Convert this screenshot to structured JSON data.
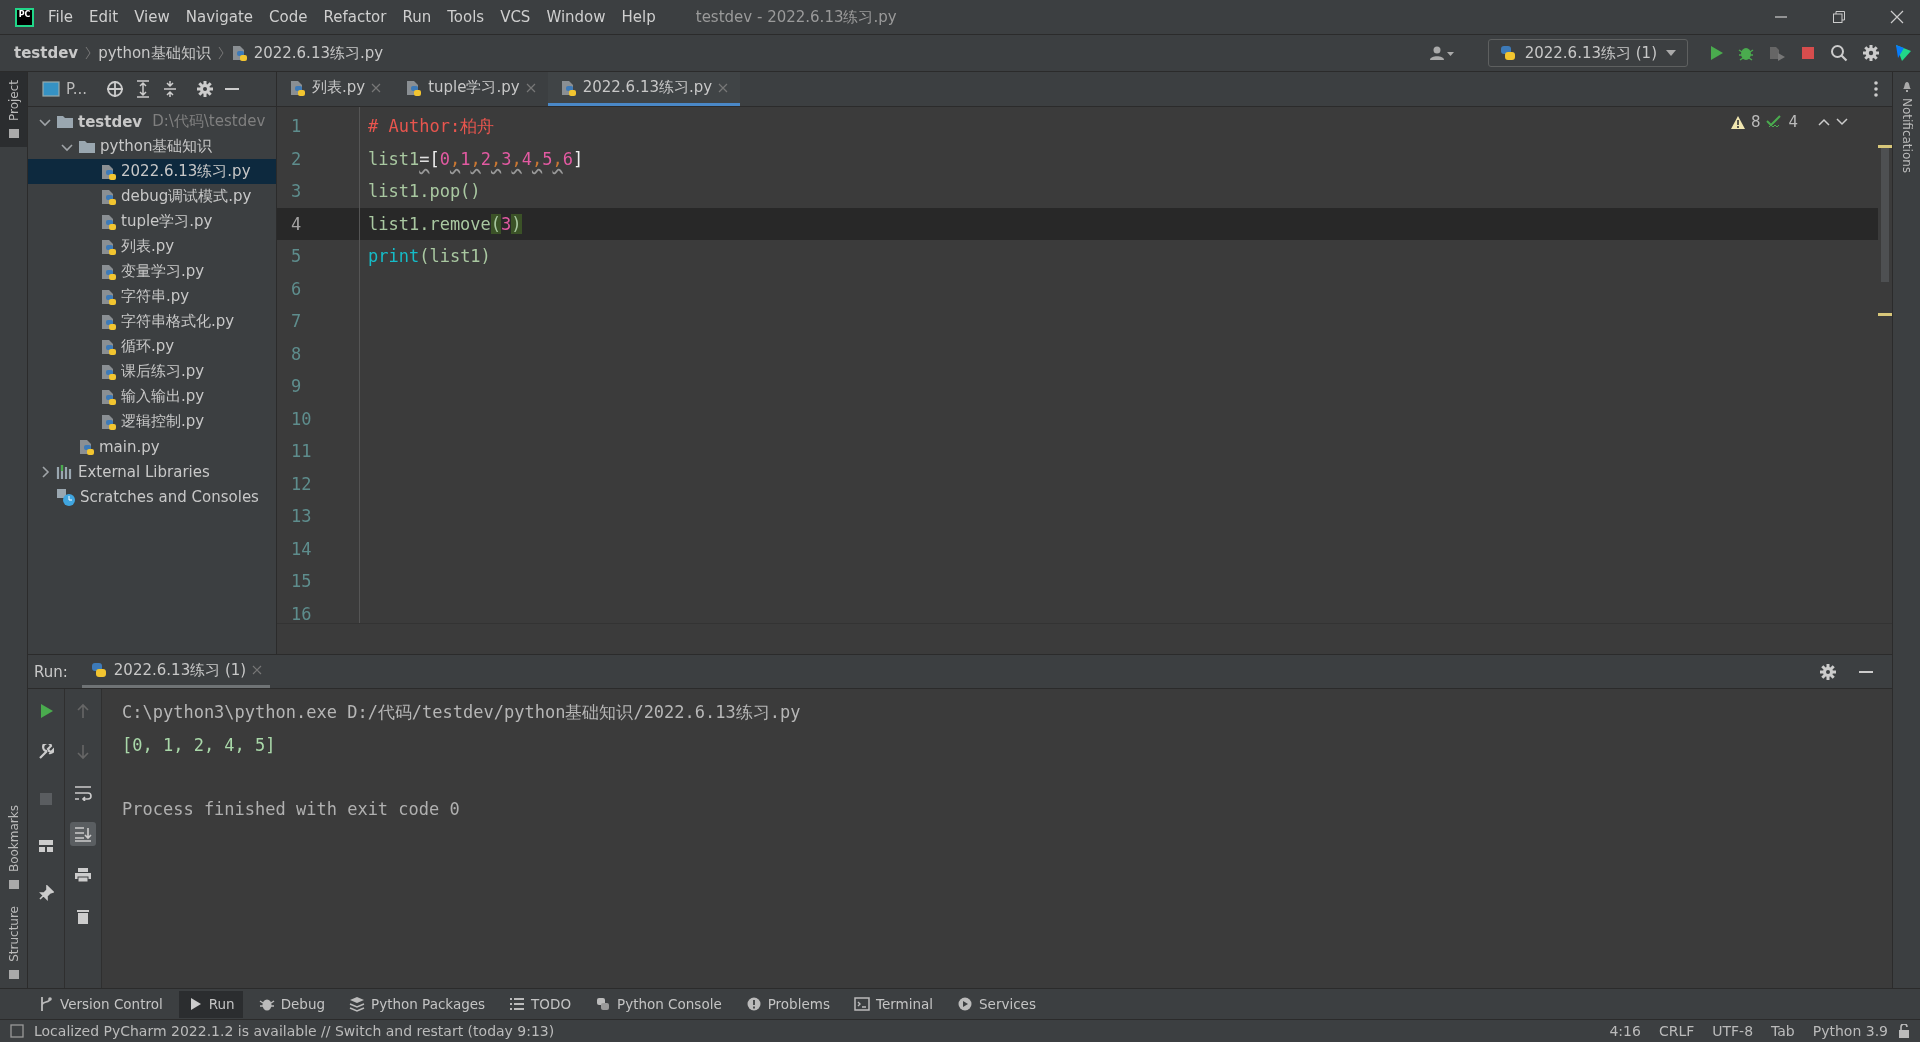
{
  "title_bar": {
    "logo_text": "PC",
    "menu": [
      "File",
      "Edit",
      "View",
      "Navigate",
      "Code",
      "Refactor",
      "Run",
      "Tools",
      "VCS",
      "Window",
      "Help"
    ],
    "title": "testdev - 2022.6.13练习.py"
  },
  "breadcrumb": [
    {
      "label": "testdev",
      "kind": "project"
    },
    {
      "label": "python基础知识",
      "kind": "folder"
    },
    {
      "label": "2022.6.13练习.py",
      "kind": "python"
    }
  ],
  "run_config": {
    "label": "2022.6.13练习 (1)"
  },
  "left_stripe": {
    "top": [
      {
        "label": "Project",
        "selected": true
      }
    ],
    "bottom": [
      {
        "label": "Bookmarks",
        "selected": false
      },
      {
        "label": "Structure",
        "selected": false
      }
    ]
  },
  "right_stripe": {
    "label": "Notifications"
  },
  "project_panel": {
    "title": "P...",
    "tree": [
      {
        "label": "testdev",
        "path": "D:\\代码\\testdev",
        "kind": "project",
        "expanded": true,
        "selected": false,
        "children": [
          {
            "label": "python基础知识",
            "kind": "folder",
            "expanded": true,
            "selected": false,
            "children": [
              {
                "label": "2022.6.13练习.py",
                "kind": "python",
                "selected": true
              },
              {
                "label": "debug调试模式.py",
                "kind": "python",
                "selected": false
              },
              {
                "label": "tuple学习.py",
                "kind": "python",
                "selected": false
              },
              {
                "label": "列表.py",
                "kind": "python",
                "selected": false
              },
              {
                "label": "变量学习.py",
                "kind": "python",
                "selected": false
              },
              {
                "label": "字符串.py",
                "kind": "python",
                "selected": false
              },
              {
                "label": "字符串格式化.py",
                "kind": "python",
                "selected": false
              },
              {
                "label": "循环.py",
                "kind": "python",
                "selected": false
              },
              {
                "label": "课后练习.py",
                "kind": "python",
                "selected": false
              },
              {
                "label": "输入输出.py",
                "kind": "python",
                "selected": false
              },
              {
                "label": "逻辑控制.py",
                "kind": "python",
                "selected": false
              }
            ]
          },
          {
            "label": "main.py",
            "kind": "python",
            "selected": false
          }
        ]
      },
      {
        "label": "External Libraries",
        "kind": "library",
        "expanded": false,
        "selected": false
      },
      {
        "label": "Scratches and Consoles",
        "kind": "scratches",
        "selected": false
      }
    ]
  },
  "editor": {
    "tabs": [
      {
        "label": "列表.py",
        "selected": false
      },
      {
        "label": "tuple学习.py",
        "selected": false
      },
      {
        "label": "2022.6.13练习.py",
        "selected": true
      }
    ],
    "inspections": {
      "warnings": "8",
      "weak_warnings": "4"
    },
    "lines": [
      {
        "number": "1",
        "current": false,
        "tokens": [
          {
            "kind": "comment",
            "text": "# Author:柏舟"
          }
        ]
      },
      {
        "number": "2",
        "current": false,
        "tokens": [
          {
            "kind": "ident",
            "text": "list1"
          },
          {
            "kind": "op-warn",
            "text": "="
          },
          {
            "kind": "bracket",
            "text": "["
          },
          {
            "kind": "number",
            "text": "0"
          },
          {
            "kind": "comma-warn",
            "text": ","
          },
          {
            "kind": "number",
            "text": "1"
          },
          {
            "kind": "comma-warn",
            "text": ","
          },
          {
            "kind": "number",
            "text": "2"
          },
          {
            "kind": "comma-warn",
            "text": ","
          },
          {
            "kind": "number",
            "text": "3"
          },
          {
            "kind": "comma-warn",
            "text": ","
          },
          {
            "kind": "number",
            "text": "4"
          },
          {
            "kind": "comma-warn",
            "text": ","
          },
          {
            "kind": "number",
            "text": "5"
          },
          {
            "kind": "comma-warn",
            "text": ","
          },
          {
            "kind": "number",
            "text": "6"
          },
          {
            "kind": "bracket",
            "text": "]"
          }
        ]
      },
      {
        "number": "3",
        "current": false,
        "tokens": [
          {
            "kind": "ident",
            "text": "list1.pop()"
          }
        ]
      },
      {
        "number": "4",
        "current": true,
        "tokens": [
          {
            "kind": "ident",
            "text": "list1.remove"
          },
          {
            "kind": "paren-match",
            "text": "("
          },
          {
            "kind": "number",
            "text": "3"
          },
          {
            "kind": "paren-match",
            "text": ")"
          }
        ]
      },
      {
        "number": "5",
        "current": false,
        "tokens": [
          {
            "kind": "builtin",
            "text": "print"
          },
          {
            "kind": "ident",
            "text": "(list1)"
          }
        ]
      },
      {
        "number": "6",
        "current": false
      },
      {
        "number": "7",
        "current": false
      },
      {
        "number": "8",
        "current": false
      },
      {
        "number": "9",
        "current": false
      },
      {
        "number": "10",
        "current": false
      },
      {
        "number": "11",
        "current": false
      },
      {
        "number": "12",
        "current": false
      },
      {
        "number": "13",
        "current": false
      },
      {
        "number": "14",
        "current": false
      },
      {
        "number": "15",
        "current": false
      },
      {
        "number": "16",
        "current": false
      }
    ]
  },
  "run_panel": {
    "label": "Run:",
    "tabs": [
      {
        "label": "2022.6.13练习 (1)",
        "selected": true
      }
    ],
    "scroll_to_end_on": true,
    "console": [
      {
        "kind": "command",
        "text": "C:\\python3\\python.exe D:/代码/testdev/python基础知识/2022.6.13练习.py"
      },
      {
        "kind": "output",
        "text": "[0, 1, 2, 4, 5]"
      },
      {
        "kind": "info",
        "text": "Process finished with exit code 0"
      }
    ]
  },
  "tool_windows": [
    {
      "label": "Version Control",
      "kind": "branch",
      "selected": false
    },
    {
      "label": "Run",
      "kind": "run",
      "selected": true
    },
    {
      "label": "Debug",
      "kind": "bug",
      "selected": false
    },
    {
      "label": "Python Packages",
      "kind": "layers",
      "selected": false
    },
    {
      "label": "TODO",
      "kind": "list",
      "selected": false
    },
    {
      "label": "Python Console",
      "kind": "python",
      "selected": false
    },
    {
      "label": "Problems",
      "kind": "info",
      "selected": false
    },
    {
      "label": "Terminal",
      "kind": "terminal",
      "selected": false
    },
    {
      "label": "Services",
      "kind": "services",
      "selected": false
    }
  ],
  "status_bar": {
    "message": "Localized PyCharm 2022.1.2 is available // Switch and restart (today 9:13)",
    "items": [
      "4:16",
      "CRLF",
      "UTF-8",
      "Tab",
      "Python 3.9"
    ]
  }
}
